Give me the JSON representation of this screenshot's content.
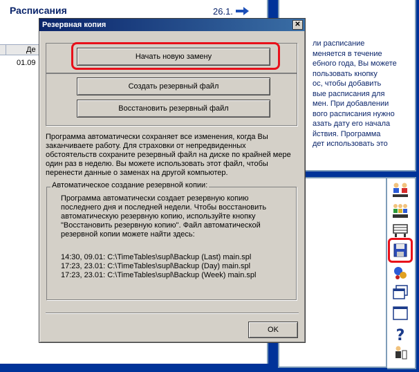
{
  "app": {
    "title": "Расписания",
    "date": "26.1.",
    "table_header_partial": "Де",
    "row_date": "01.09"
  },
  "help_panel": {
    "lines": [
      "ли расписание",
      "меняется в течение",
      "ебного года, Вы можете",
      "пользовать кнопку",
      "ос, чтобы добавить",
      "вые расписания для",
      "мен. При добавлении",
      "вого расписания нужно",
      "азать дату его начала",
      "йствия. Программа",
      "дет использовать это"
    ]
  },
  "dialog": {
    "title": "Резервная копия",
    "close_glyph": "✕",
    "btn_new": "Начать новую замену",
    "btn_create": "Создать резервный файл",
    "btn_restore": "Восстановить резервный файл",
    "info_text": "Программа автоматически сохраняет все изменения, когда Вы заканчиваете работу. Для страховки от непредвиденных обстоятельств сохраните резервный файл на диске по крайней мере один раз в неделю. Вы можете использовать этот файл, чтобы перенести данные о заменах на другой компьютер.",
    "auto_group_caption": "Автоматическое создание резервной копии:",
    "auto_text": "Программа автоматически создает резервную копию последнего дня и последней недели. Чтобы восстановить автоматическую резервную копию, используйте кнопку \"Восстановить резервную копию\". Файл автоматической резервной копии можете найти здесь:",
    "backup_paths": [
      "14:30, 09.01: C:\\TimeTables\\supl\\Backup (Last) main.spl",
      "17:23, 23.01: C:\\TimeTables\\supl\\Backup (Day) main.spl",
      "17:23, 23.01: C:\\TimeTables\\supl\\Backup (Week) main.spl"
    ],
    "ok_label": "OK"
  },
  "toolbar": {
    "icons": [
      "teachers-icon",
      "classes-icon",
      "rooms-icon",
      "save-icon",
      "tools-icon",
      "windows-icon",
      "window-icon",
      "help-icon",
      "user-icon"
    ]
  },
  "colors": {
    "highlight": "#e8101a",
    "titlebar": "#0a246a",
    "desktop": "#003399"
  }
}
